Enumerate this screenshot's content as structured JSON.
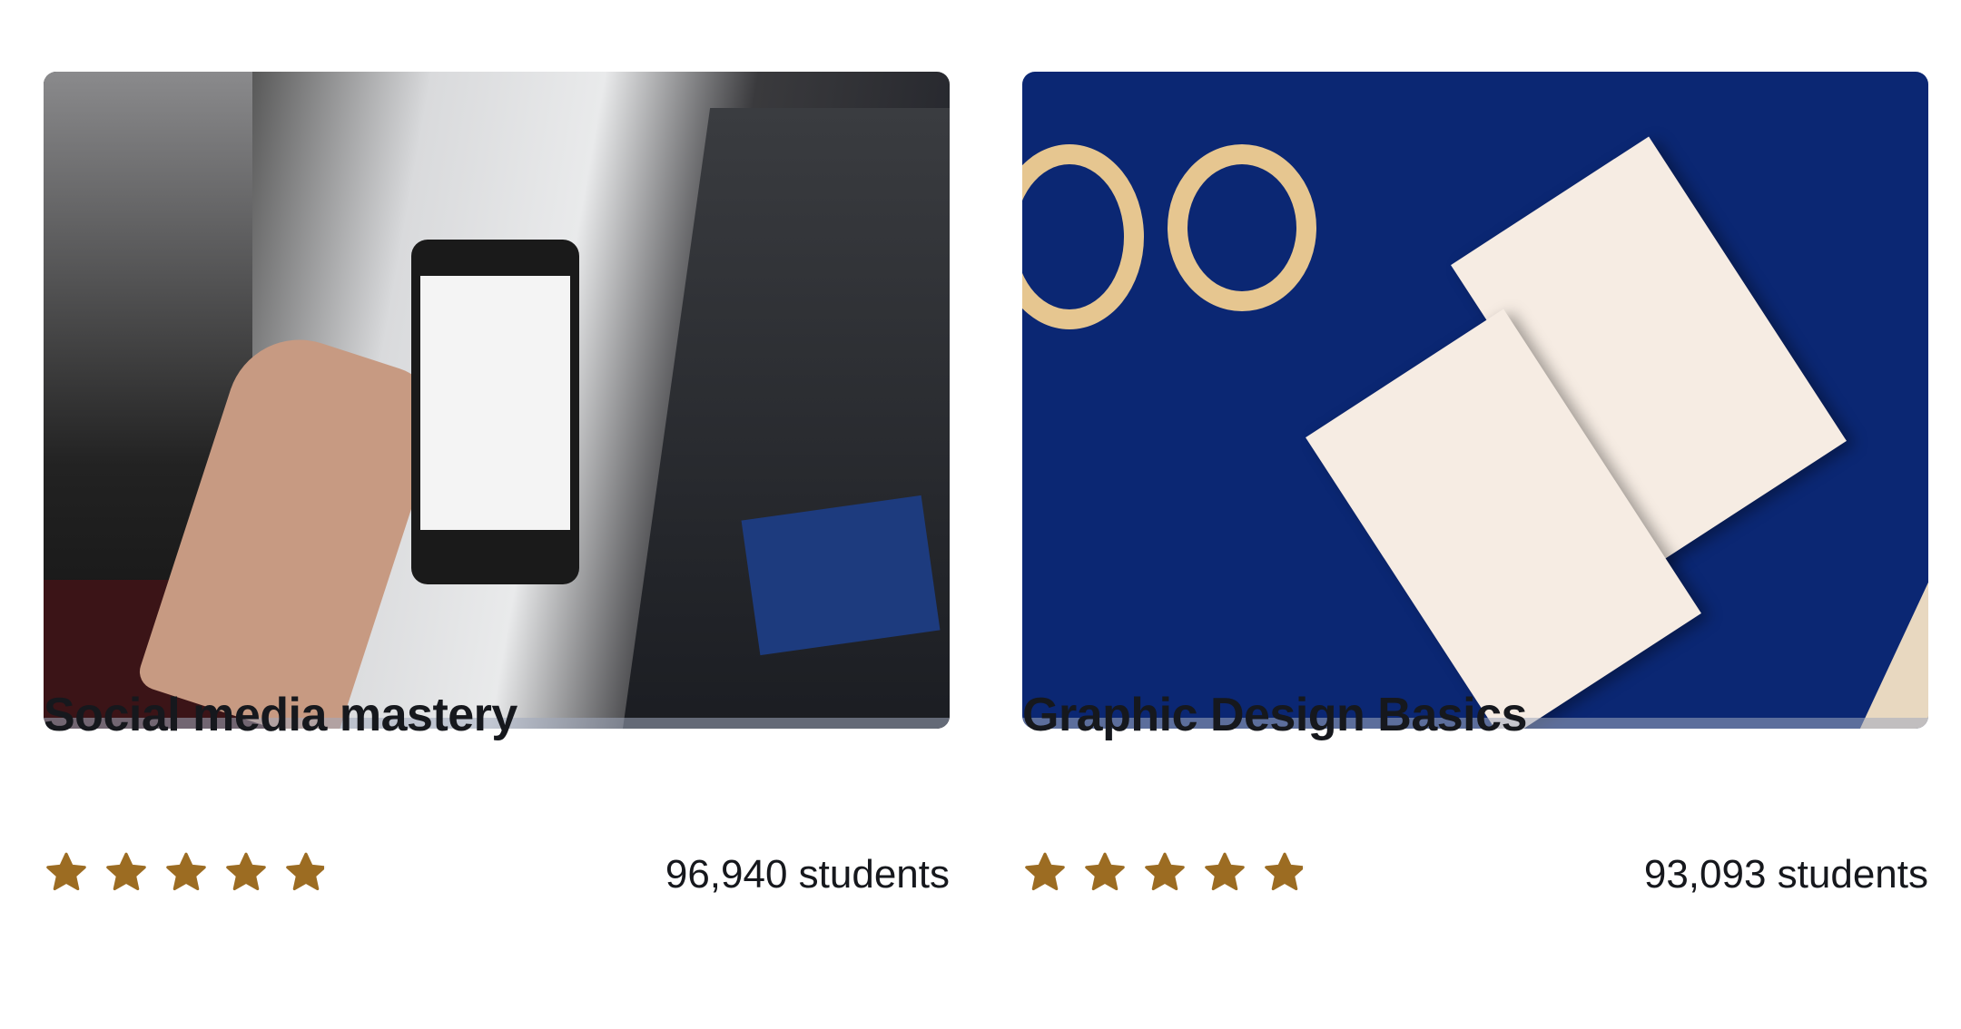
{
  "courses": [
    {
      "title": "Social media mastery",
      "rating_fraction_of_five": 4.9,
      "students": "96,940 students",
      "thumbnail": "phone-in-city-photo"
    },
    {
      "title": "Graphic Design Basics",
      "rating_fraction_of_five": 4.9,
      "students": "93,093 students",
      "thumbnail": "business-cards-photo"
    }
  ],
  "colors": {
    "star": "#9c6c22",
    "text": "#16181d",
    "thumb2_bg": "#0b2773"
  }
}
